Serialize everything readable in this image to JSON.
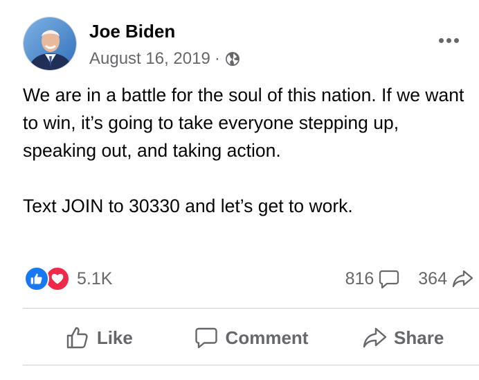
{
  "post": {
    "author": "Joe Biden",
    "date": "August 16, 2019",
    "separator": "·",
    "privacy_icon": "globe-icon",
    "more_icon": "more-options-icon",
    "body": [
      "We are in a battle for the soul of this nation. If we want to win, it’s going to take everyone stepping up, speaking out, and taking action.",
      "Text JOIN to 30330 and let’s get to work."
    ]
  },
  "stats": {
    "reactions_count": "5.1K",
    "reaction_icons": [
      "like-reaction-icon",
      "love-reaction-icon"
    ],
    "comments_count": "816",
    "shares_count": "364"
  },
  "actions": {
    "like": "Like",
    "comment": "Comment",
    "share": "Share"
  },
  "colors": {
    "primary_text": "#050505",
    "secondary_text": "#65676b",
    "like_blue": "#1877f2",
    "love_red": "#f02849",
    "divider": "#ced0d4"
  }
}
